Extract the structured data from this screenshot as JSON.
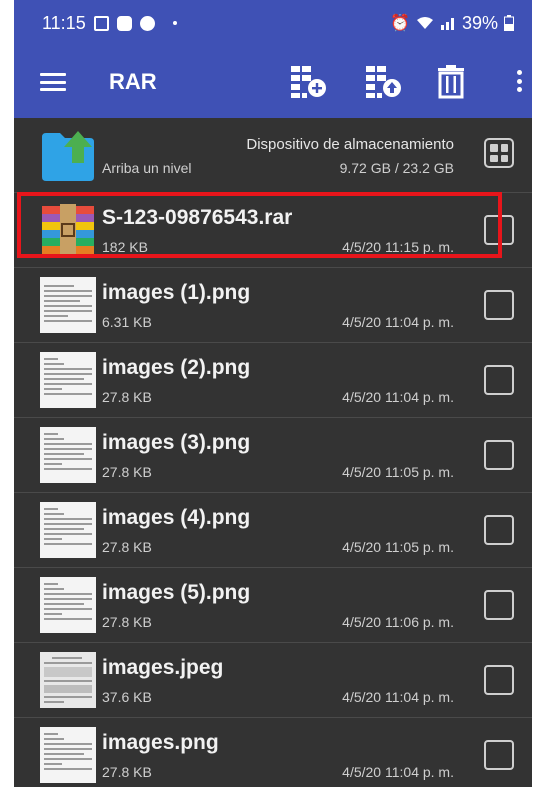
{
  "status_bar": {
    "time": "11:15",
    "battery": "39%"
  },
  "app_bar": {
    "title": "RAR"
  },
  "parent_row": {
    "storage_label": "Dispositivo de almacenamiento",
    "up_label": "Arriba un nivel",
    "storage_usage": "9.72 GB / 23.2 GB"
  },
  "files": [
    {
      "name": "S-123-09876543.rar",
      "size": "182 KB",
      "date": "4/5/20 11:15 p. m.",
      "icon": "rar-archive-icon",
      "highlighted": true
    },
    {
      "name": "images (1).png",
      "size": "6.31 KB",
      "date": "4/5/20 11:04 p. m.",
      "icon": "document-thumbnail"
    },
    {
      "name": "images (2).png",
      "size": "27.8 KB",
      "date": "4/5/20 11:04 p. m.",
      "icon": "document-thumbnail"
    },
    {
      "name": "images (3).png",
      "size": "27.8 KB",
      "date": "4/5/20 11:05 p. m.",
      "icon": "document-thumbnail"
    },
    {
      "name": "images (4).png",
      "size": "27.8 KB",
      "date": "4/5/20 11:05 p. m.",
      "icon": "document-thumbnail"
    },
    {
      "name": "images (5).png",
      "size": "27.8 KB",
      "date": "4/5/20 11:06 p. m.",
      "icon": "document-thumbnail"
    },
    {
      "name": "images.jpeg",
      "size": "37.6 KB",
      "date": "4/5/20 11:04 p. m.",
      "icon": "document-thumbnail"
    },
    {
      "name": "images.png",
      "size": "27.8 KB",
      "date": "4/5/20 11:04 p. m.",
      "icon": "document-thumbnail"
    }
  ],
  "colors": {
    "app_bar": "#3f51b5",
    "list_background": "#333333",
    "highlight": "#e8151b"
  }
}
